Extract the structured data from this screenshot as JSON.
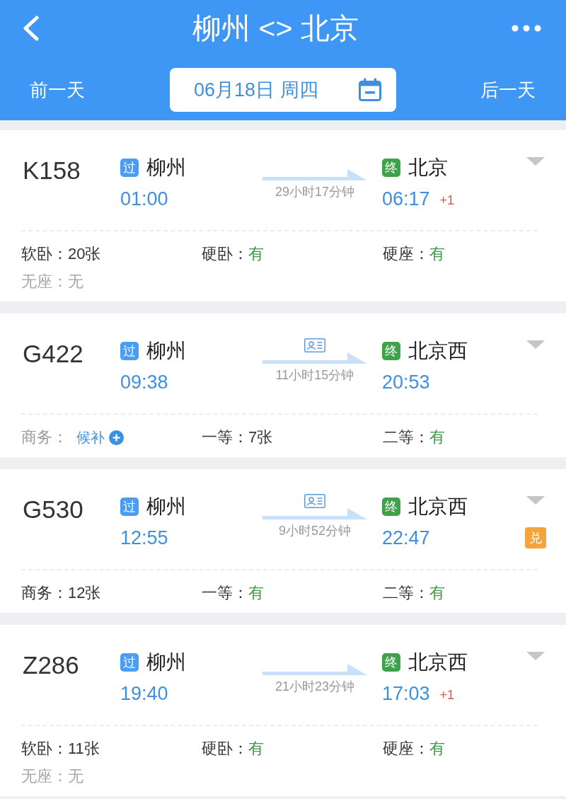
{
  "header": {
    "title": "柳州 <> 北京",
    "prev_day": "前一天",
    "date": "06月18日 周四",
    "next_day": "后一天"
  },
  "trains": [
    {
      "number": "K158",
      "origin": {
        "tag": "过",
        "name": "柳州",
        "time": "01:00"
      },
      "destination": {
        "tag": "终",
        "name": "北京",
        "time": "06:17",
        "day_offset": "+1"
      },
      "duration": "29小时17分钟",
      "id_card": false,
      "seats": [
        {
          "label": "软卧：",
          "value": "20张",
          "kind": "count"
        },
        {
          "label": "硬卧：",
          "value": "有",
          "kind": "available"
        },
        {
          "label": "硬座：",
          "value": "有",
          "kind": "available"
        },
        {
          "label": "无座：",
          "value": "无",
          "kind": "none"
        }
      ]
    },
    {
      "number": "G422",
      "origin": {
        "tag": "过",
        "name": "柳州",
        "time": "09:38"
      },
      "destination": {
        "tag": "终",
        "name": "北京西",
        "time": "20:53"
      },
      "duration": "11小时15分钟",
      "id_card": true,
      "seats": [
        {
          "label": "商务：",
          "value": "候补",
          "kind": "waitlist"
        },
        {
          "label": "一等：",
          "value": "7张",
          "kind": "count"
        },
        {
          "label": "二等：",
          "value": "有",
          "kind": "available"
        }
      ]
    },
    {
      "number": "G530",
      "origin": {
        "tag": "过",
        "name": "柳州",
        "time": "12:55"
      },
      "destination": {
        "tag": "终",
        "name": "北京西",
        "time": "22:47"
      },
      "duration": "9小时52分钟",
      "id_card": true,
      "badge": "兑",
      "seats": [
        {
          "label": "商务：",
          "value": "12张",
          "kind": "count"
        },
        {
          "label": "一等：",
          "value": "有",
          "kind": "available"
        },
        {
          "label": "二等：",
          "value": "有",
          "kind": "available"
        }
      ]
    },
    {
      "number": "Z286",
      "origin": {
        "tag": "过",
        "name": "柳州",
        "time": "19:40"
      },
      "destination": {
        "tag": "终",
        "name": "北京西",
        "time": "17:03",
        "day_offset": "+1"
      },
      "duration": "21小时23分钟",
      "id_card": false,
      "seats": [
        {
          "label": "软卧：",
          "value": "11张",
          "kind": "count"
        },
        {
          "label": "硬卧：",
          "value": "有",
          "kind": "available"
        },
        {
          "label": "硬座：",
          "value": "有",
          "kind": "available"
        },
        {
          "label": "无座：",
          "value": "无",
          "kind": "none"
        }
      ]
    }
  ]
}
